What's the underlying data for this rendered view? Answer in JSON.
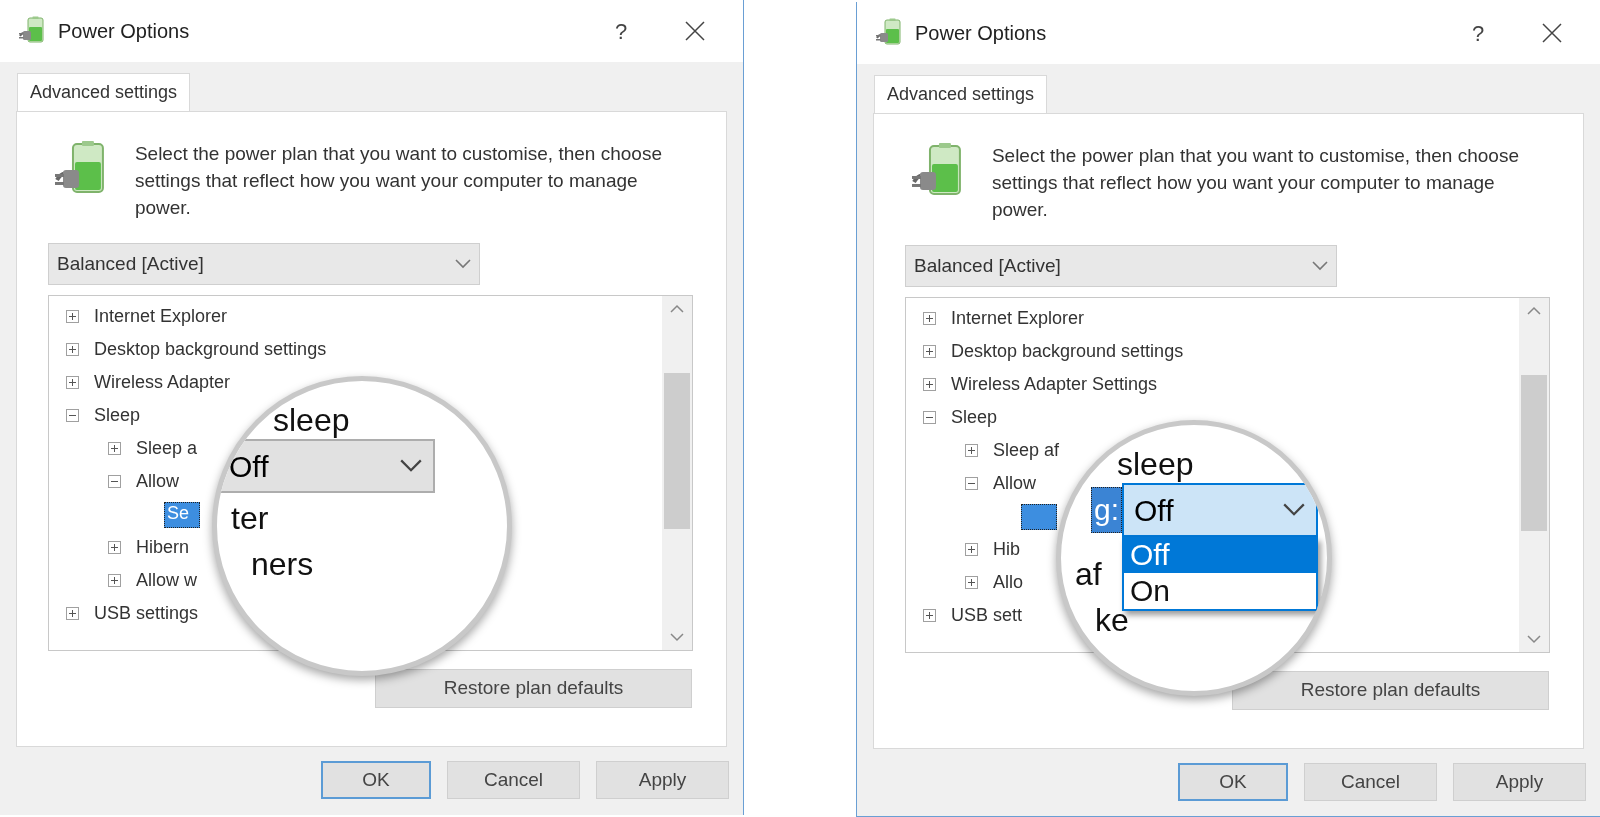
{
  "dialogs": [
    {
      "title": "Power Options",
      "help": "?",
      "tabs": [
        {
          "label": "Advanced settings",
          "selected": true
        }
      ],
      "description": "Select the power plan that you want to customise, then choose settings that reflect how you want your computer to manage power.",
      "plan_dropdown": {
        "value": "Balanced [Active]"
      },
      "tree": [
        {
          "label": "Internet Explorer",
          "expanded": false,
          "selected": false
        },
        {
          "label": "Desktop background settings",
          "expanded": false,
          "selected": false
        },
        {
          "label": "Wireless Adapter",
          "expanded": false,
          "selected": false
        },
        {
          "label": "Sleep",
          "expanded": true,
          "selected": false,
          "children": [
            {
              "label": "Sleep a",
              "expanded": false,
              "selected": false
            },
            {
              "label": "Allow",
              "expanded": true,
              "selected": false,
              "children": [
                {
                  "label": "Se",
                  "selected": true
                }
              ]
            },
            {
              "label": "Hibern",
              "expanded": false,
              "selected": false
            },
            {
              "label": "Allow w",
              "expanded": false,
              "selected": false
            }
          ]
        },
        {
          "label": "USB settings",
          "expanded": false,
          "selected": false
        }
      ],
      "magnifier": {
        "above": "sleep",
        "dropdown": {
          "value": "Off",
          "open": false
        },
        "below": [
          "ter",
          "ners"
        ]
      },
      "restore_button": "Restore plan defaults",
      "buttons": [
        {
          "label": "OK",
          "default": true
        },
        {
          "label": "Cancel",
          "default": false
        },
        {
          "label": "Apply",
          "default": false
        }
      ]
    },
    {
      "title": "Power Options",
      "help": "?",
      "tabs": [
        {
          "label": "Advanced settings",
          "selected": true
        }
      ],
      "description": "Select the power plan that you want to customise, then choose settings that reflect how you want your computer to manage power.",
      "plan_dropdown": {
        "value": "Balanced [Active]"
      },
      "tree": [
        {
          "label": "Internet Explorer",
          "expanded": false,
          "selected": false
        },
        {
          "label": "Desktop background settings",
          "expanded": false,
          "selected": false
        },
        {
          "label": "Wireless Adapter Settings",
          "expanded": false,
          "selected": false
        },
        {
          "label": "Sleep",
          "expanded": true,
          "selected": false,
          "children": [
            {
              "label": "Sleep af",
              "expanded": false,
              "selected": false
            },
            {
              "label": "Allow",
              "expanded": true,
              "selected": false,
              "children": [
                {
                  "selected": true
                }
              ]
            },
            {
              "label": "Hib",
              "expanded": false,
              "selected": false
            },
            {
              "label": "Allo",
              "expanded": false,
              "selected": false
            }
          ]
        },
        {
          "label": "USB sett",
          "expanded": false,
          "selected": false
        }
      ],
      "magnifier": {
        "above": "sleep",
        "label": "g:",
        "dropdown": {
          "value": "Off",
          "open": true,
          "options": [
            {
              "label": "Off",
              "selected": true
            },
            {
              "label": "On",
              "selected": false
            }
          ]
        },
        "below": [
          "af",
          "ke"
        ]
      },
      "restore_button": "Restore plan defaults",
      "buttons": [
        {
          "label": "OK",
          "default": true
        },
        {
          "label": "Cancel",
          "default": false
        },
        {
          "label": "Apply",
          "default": false
        }
      ]
    }
  ]
}
